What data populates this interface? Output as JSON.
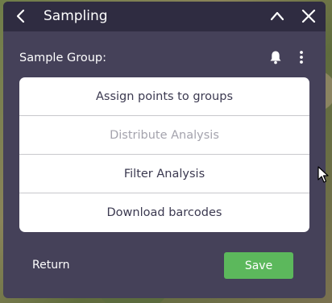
{
  "header": {
    "title": "Sampling"
  },
  "sample_group": {
    "label": "Sample Group:"
  },
  "menu": {
    "items": [
      {
        "label": "Assign points to groups",
        "enabled": true
      },
      {
        "label": "Distribute Analysis",
        "enabled": false
      },
      {
        "label": "Filter Analysis",
        "enabled": true
      },
      {
        "label": "Download barcodes",
        "enabled": true
      }
    ]
  },
  "footer": {
    "return_label": "Return",
    "save_label": "Save"
  },
  "colors": {
    "header_bg": "#2f2c41",
    "panel_bg": "#454159",
    "save_button": "#5cb85c",
    "disabled_text": "#a4a3ad"
  },
  "icons": [
    "chevron-left-icon",
    "chevron-up-icon",
    "close-icon",
    "bell-icon",
    "more-vertical-icon",
    "mouse-cursor-icon"
  ]
}
